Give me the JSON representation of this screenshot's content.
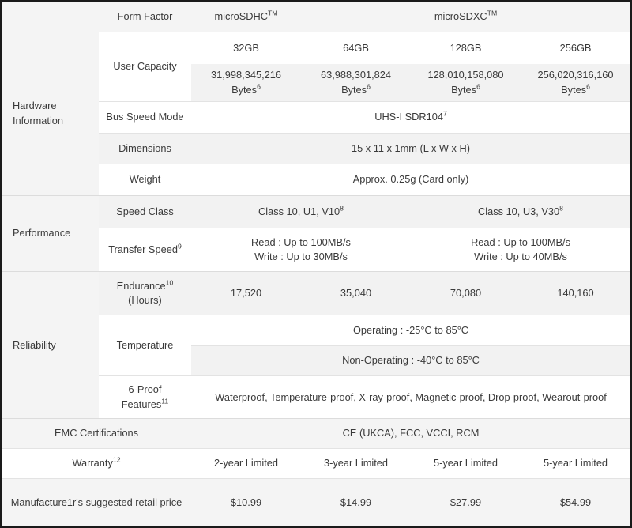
{
  "table": {
    "sections": {
      "hardware": "Hardware Information",
      "performance": "Performance",
      "reliability": "Reliability"
    },
    "rows": {
      "form_factor": {
        "label": "Form Factor",
        "sdhc": "microSDHC",
        "sdhc_sup": "TM",
        "sdxc": "microSDXC",
        "sdxc_sup": "TM"
      },
      "user_capacity": {
        "label": "User Capacity",
        "capacities": [
          "32GB",
          "64GB",
          "128GB",
          "256GB"
        ],
        "bytes": [
          "31,998,345,216",
          "63,988,301,824",
          "128,010,158,080",
          "256,020,316,160"
        ],
        "bytes_unit": "Bytes",
        "bytes_sup": "6"
      },
      "bus_speed": {
        "label": "Bus Speed Mode",
        "value": "UHS-I SDR104",
        "value_sup": "7"
      },
      "dimensions": {
        "label": "Dimensions",
        "value": "15 x 11 x 1mm (L x W x H)"
      },
      "weight": {
        "label": "Weight",
        "value": "Approx. 0.25g (Card only)"
      },
      "speed_class": {
        "label": "Speed Class",
        "sdhc_value": "Class 10, U1, V10",
        "sdhc_sup": "8",
        "sdxc_value": "Class 10, U3, V30",
        "sdxc_sup": "8"
      },
      "transfer_speed": {
        "label": "Transfer Speed",
        "label_sup": "9",
        "sdhc_read": "Read : Up to 100MB/s",
        "sdhc_write": "Write : Up to 30MB/s",
        "sdxc_read": "Read : Up to 100MB/s",
        "sdxc_write": "Write : Up to 40MB/s"
      },
      "endurance": {
        "label": "Endurance",
        "label_sup": "10",
        "label_line2": "(Hours)",
        "values": [
          "17,520",
          "35,040",
          "70,080",
          "140,160"
        ]
      },
      "temperature": {
        "label": "Temperature",
        "operating": "Operating : -25°C to 85°C",
        "non_operating": "Non-Operating : -40°C to 85°C"
      },
      "six_proof": {
        "label": "6-Proof",
        "label_line2": "Features",
        "label_sup": "11",
        "value": "Waterproof, Temperature-proof, X-ray-proof, Magnetic-proof, Drop-proof, Wearout-proof"
      },
      "emc": {
        "label": "EMC Certifications",
        "value": "CE (UKCA), FCC, VCCI, RCM"
      },
      "warranty": {
        "label": "Warranty",
        "label_sup": "12",
        "values": [
          "2-year Limited",
          "3-year Limited",
          "5-year Limited",
          "5-year Limited"
        ]
      },
      "msrp": {
        "label": "Manufacture1r's suggested retail price",
        "values": [
          "$10.99",
          "$14.99",
          "$27.99",
          "$54.99"
        ]
      }
    }
  }
}
